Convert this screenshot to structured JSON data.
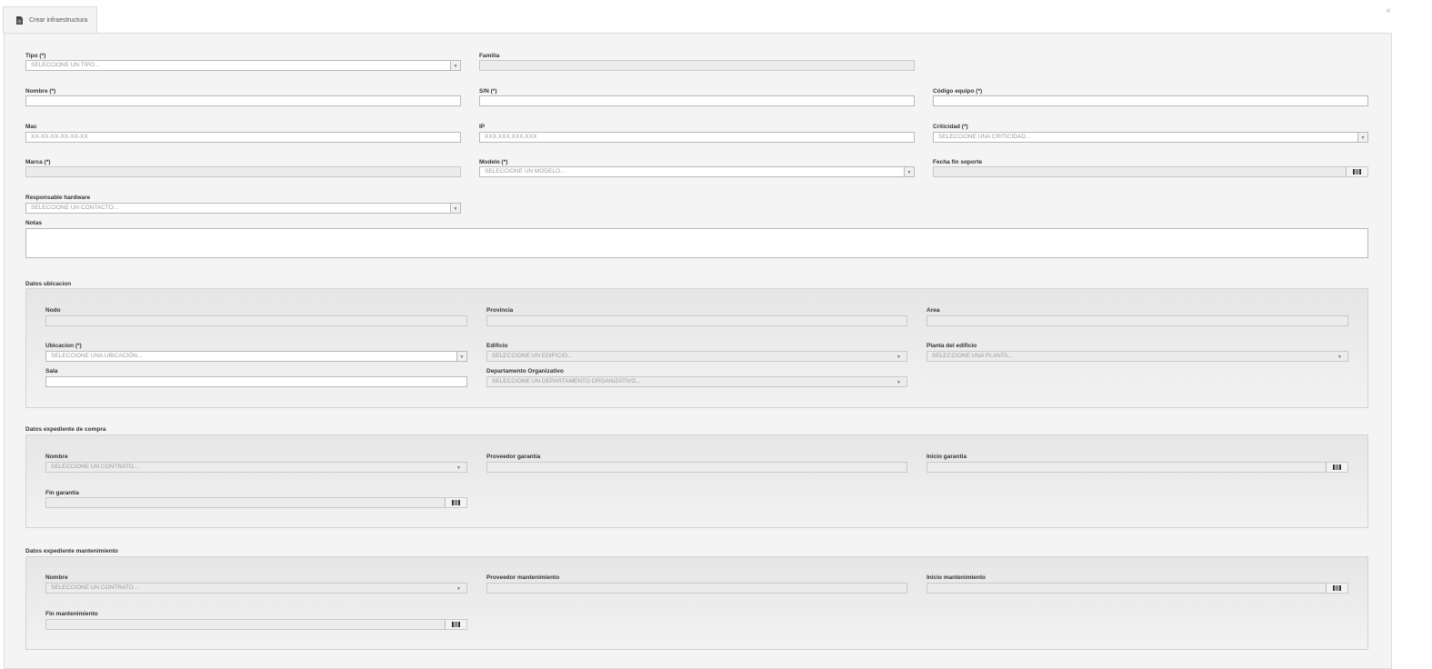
{
  "tab": {
    "title": "Crear infraestructura",
    "icon": "document-icon"
  },
  "close_icon": "×",
  "form": {
    "tipo": {
      "label": "Tipo (*)",
      "placeholder": "SELECCIONE UN TIPO..."
    },
    "familia": {
      "label": "Familia"
    },
    "nombre": {
      "label": "Nombre (*)"
    },
    "sn": {
      "label": "S/N (*)"
    },
    "codigo": {
      "label": "Código equipo (*)"
    },
    "mac": {
      "label": "Mac",
      "placeholder": "XX-XX-XX-XX-XX-XX"
    },
    "ip": {
      "label": "IP",
      "placeholder": "XXX.XXX.XXX.XXX"
    },
    "criticidad": {
      "label": "Criticidad (*)",
      "placeholder": "SELECCIONE UNA CRITICIDAD..."
    },
    "marca": {
      "label": "Marca (*)"
    },
    "modelo": {
      "label": "Modelo (*)",
      "placeholder": "SELECCIONE UN MODELO..."
    },
    "fecha_fin_soporte": {
      "label": "Fecha fin soporte"
    },
    "responsable": {
      "label": "Responsable hardware",
      "placeholder": "SELECCIONE UN CONTACTO..."
    },
    "notas": {
      "label": "Notas"
    }
  },
  "ubicacion": {
    "title": "Datos ubicacion",
    "nodo": {
      "label": "Nodo"
    },
    "provincia": {
      "label": "Provincia"
    },
    "area": {
      "label": "Area"
    },
    "ubicacion": {
      "label": "Ubicacion (*)",
      "placeholder": "SELECCIONE UNA UBICACIÓN..."
    },
    "edificio": {
      "label": "Edificio",
      "placeholder": "SELECCIONE UN EDIFICIO..."
    },
    "planta": {
      "label": "Planta del edificio",
      "placeholder": "SELECCIONE UNA PLANTA..."
    },
    "sala": {
      "label": "Sala"
    },
    "departamento": {
      "label": "Departamento Organizativo",
      "placeholder": "SELECCIONE UN DEPARTAMENTO ORGANIZATIVO..."
    }
  },
  "compra": {
    "title": "Datos expediente de compra",
    "nombre": {
      "label": "Nombre",
      "placeholder": "SELECCIONE UN CONTRATO..."
    },
    "proveedor": {
      "label": "Proveedor garantia"
    },
    "inicio": {
      "label": "Inicio garantia"
    },
    "fin": {
      "label": "Fin garantia"
    }
  },
  "mantenimiento": {
    "title": "Datos expediente mantenimiento",
    "nombre": {
      "label": "Nombre",
      "placeholder": "SELECCIONE UN CONTRATO..."
    },
    "proveedor": {
      "label": "Proveedor mantenimiento"
    },
    "inicio": {
      "label": "Inicio mantenimiento"
    },
    "fin": {
      "label": "Fin mantenimiento"
    }
  }
}
